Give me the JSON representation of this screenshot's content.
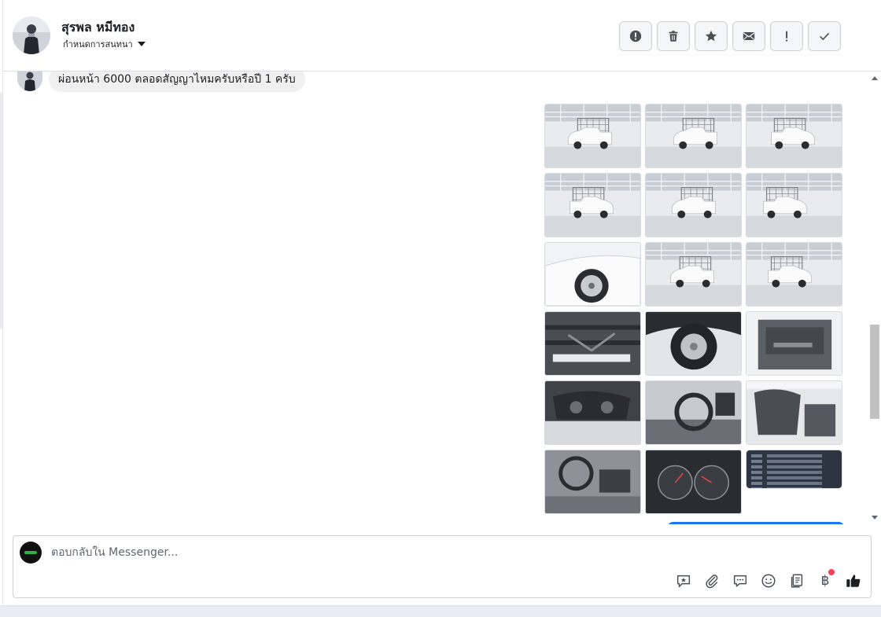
{
  "header": {
    "contact_name": "สุรพล หมีทอง",
    "subtitle": "กำหนดการสนทนา",
    "actions": [
      {
        "name": "spam-button",
        "icon": "exclamation-circle-icon",
        "glyph": ""
      },
      {
        "name": "delete-button",
        "icon": "trash-icon",
        "glyph": ""
      },
      {
        "name": "star-button",
        "icon": "star-icon",
        "glyph": ""
      },
      {
        "name": "mark-unread-button",
        "icon": "envelope-icon",
        "glyph": ""
      },
      {
        "name": "follow-up-button",
        "icon": "exclamation-icon",
        "glyph": "!"
      },
      {
        "name": "mark-done-button",
        "icon": "check-icon",
        "glyph": ""
      }
    ]
  },
  "thread": {
    "incoming_message": "ผ่อนหน้า 6000 ตลอดสัญญาไหมครับหรือปี 1 ครับ",
    "photo_count": 18
  },
  "composer": {
    "placeholder": "ตอบกลับใน Messenger...",
    "tools": [
      {
        "name": "saved-reply-icon"
      },
      {
        "name": "attachment-icon"
      },
      {
        "name": "chat-bubble-icon"
      },
      {
        "name": "emoji-icon"
      },
      {
        "name": "catalog-icon"
      },
      {
        "name": "baht-payment-icon",
        "glyph": "฿",
        "has_notification": true
      },
      {
        "name": "like-icon"
      }
    ]
  },
  "colors": {
    "accent": "#1877f2",
    "button_bg": "#f5f6f7",
    "notification": "#fa3e5e"
  }
}
